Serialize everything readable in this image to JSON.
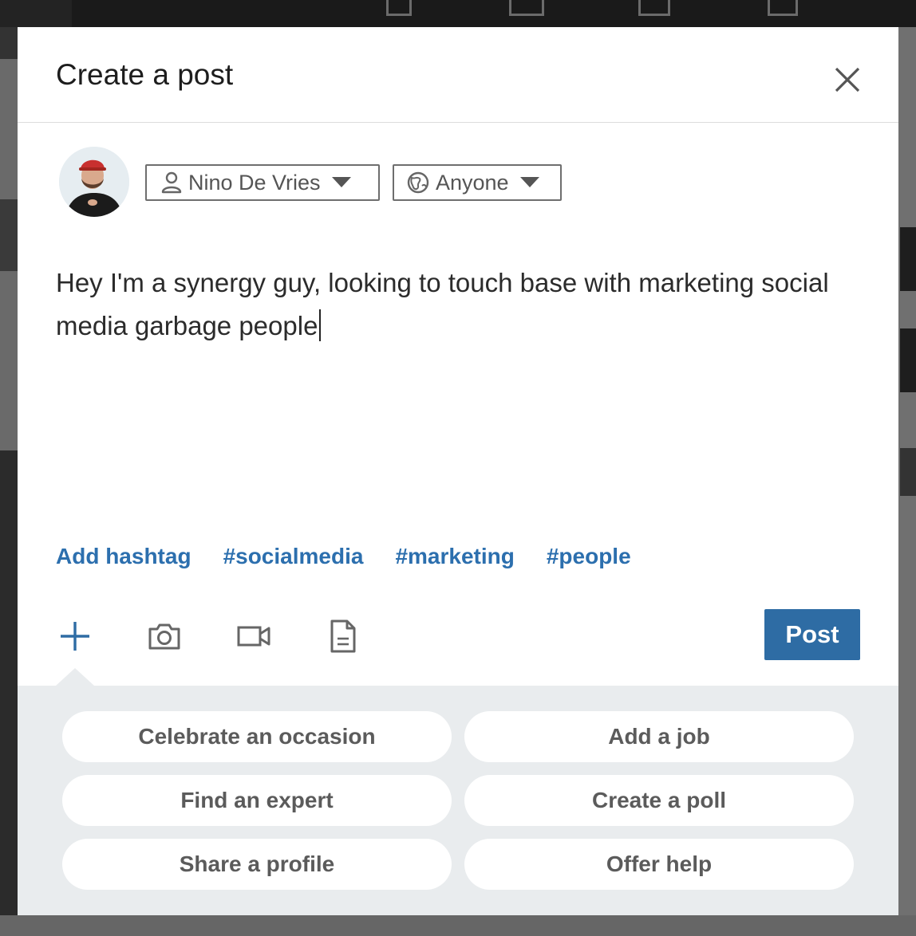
{
  "modal": {
    "title": "Create a post"
  },
  "composer": {
    "author_name": "Nino De Vries",
    "visibility": "Anyone",
    "text": "Hey I'm a synergy guy, looking to touch base with marketing social media garbage people"
  },
  "hashtags": {
    "add_label": "Add hashtag",
    "suggestions": [
      "#socialmedia",
      "#marketing",
      "#people"
    ]
  },
  "toolbar": {
    "icons": [
      "plus-icon",
      "camera-icon",
      "video-icon",
      "document-icon"
    ],
    "post_label": "Post"
  },
  "options": [
    "Celebrate an occasion",
    "Add a job",
    "Find an expert",
    "Create a poll",
    "Share a profile",
    "Offer help"
  ],
  "colors": {
    "accent": "#2e6ca4",
    "hashtag": "#2c6fae",
    "panel_bg": "#e9ecee"
  }
}
